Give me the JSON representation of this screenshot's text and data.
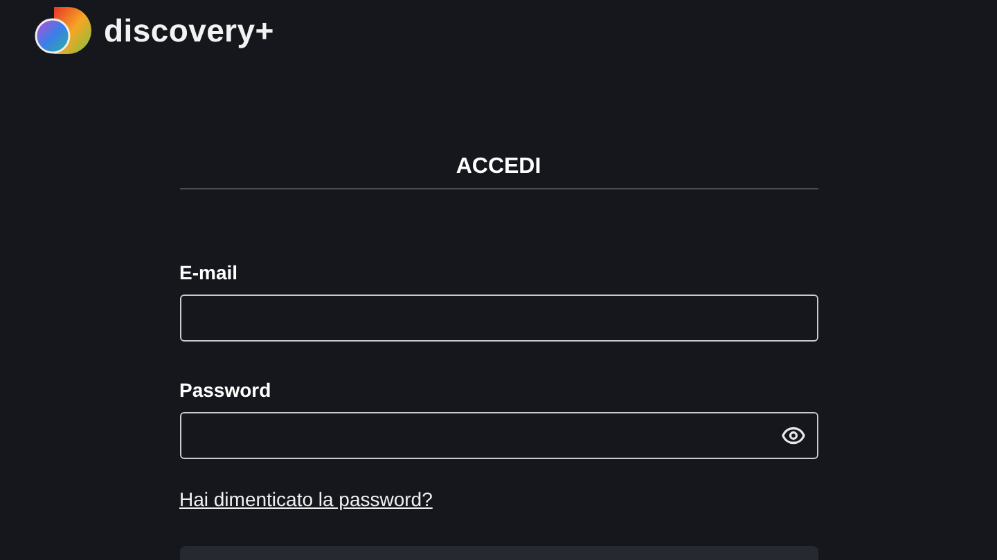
{
  "header": {
    "brand": "discovery+"
  },
  "form": {
    "title": "ACCEDI",
    "fields": [
      {
        "label": "E-mail",
        "kind": "text"
      },
      {
        "label": "Password",
        "kind": "password"
      }
    ],
    "forgot_link": "Hai dimenticato la password?"
  }
}
